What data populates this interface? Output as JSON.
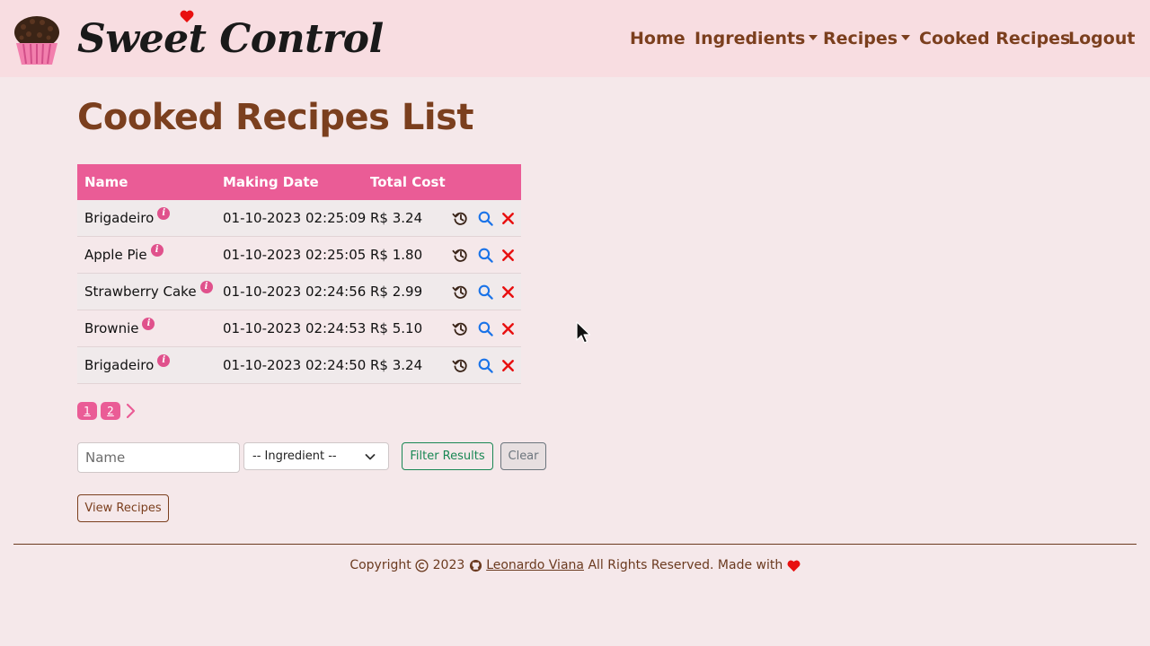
{
  "brand": {
    "name": "Sweet Control"
  },
  "nav": {
    "home": "Home",
    "ingredients": "Ingredients",
    "recipes": "Recipes",
    "cooked_recipes": "Cooked Recipes",
    "logout": "Logout"
  },
  "page": {
    "title": "Cooked Recipes List"
  },
  "table": {
    "headers": {
      "name": "Name",
      "making_date": "Making Date",
      "total_cost": "Total Cost"
    },
    "rows": [
      {
        "name": "Brigadeiro",
        "date": "01-10-2023 02:25:09",
        "cost": "R$ 3.24"
      },
      {
        "name": "Apple Pie",
        "date": "01-10-2023 02:25:05",
        "cost": "R$ 1.80"
      },
      {
        "name": "Strawberry Cake",
        "date": "01-10-2023 02:24:56",
        "cost": "R$ 2.99"
      },
      {
        "name": "Brownie",
        "date": "01-10-2023 02:24:53",
        "cost": "R$ 5.10"
      },
      {
        "name": "Brigadeiro",
        "date": "01-10-2023 02:24:50",
        "cost": "R$ 3.24"
      }
    ]
  },
  "pagination": {
    "pages": [
      "1",
      "2"
    ]
  },
  "filters": {
    "name_placeholder": "Name",
    "ingredient_selected": "-- Ingredient --",
    "filter_button": "Filter Results",
    "clear_button": "Clear"
  },
  "actions": {
    "view_recipes": "View Recipes"
  },
  "footer": {
    "copyright_prefix": "Copyright",
    "year": "2023",
    "author": "Leonardo Viana",
    "suffix": "All Rights Reserved. Made with"
  },
  "colors": {
    "accent_pink": "#ea5c96",
    "brown": "#7b3f1e",
    "navbar_bg": "#f8dde1",
    "page_bg": "#f5e8ea",
    "history_icon": "#3a2418",
    "search_icon": "#1a73e8",
    "delete_icon": "#e81010"
  },
  "icons": {
    "row_actions": [
      "history-icon",
      "search-icon",
      "close-icon"
    ],
    "info": "info-icon",
    "footer": [
      "copyright-icon",
      "github-icon",
      "heart-icon"
    ]
  }
}
